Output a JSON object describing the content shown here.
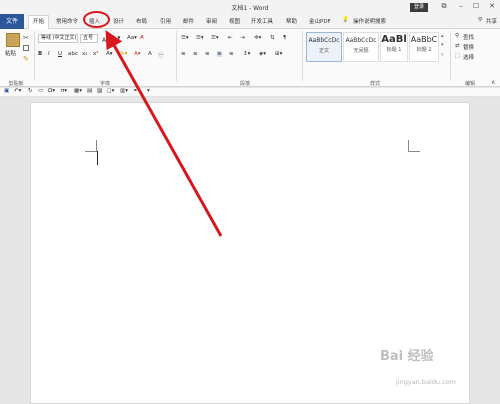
{
  "window": {
    "title": "文档1 - Word",
    "login_label": "登录",
    "minimize_glyph": "–",
    "restore_glyph": "☐",
    "close_glyph": "✕",
    "restore_icon": "restore-window-icon"
  },
  "tabs": [
    {
      "label": "文件"
    },
    {
      "label": "开始"
    },
    {
      "label": "常用命令"
    },
    {
      "label": "插入"
    },
    {
      "label": "设计"
    },
    {
      "label": "布局"
    },
    {
      "label": "引用"
    },
    {
      "label": "邮件"
    },
    {
      "label": "审阅"
    },
    {
      "label": "视图"
    },
    {
      "label": "开发工具"
    },
    {
      "label": "帮助"
    },
    {
      "label": "金山PDF"
    },
    {
      "label": "操作说明搜索"
    }
  ],
  "share_label": "共享",
  "ribbon": {
    "clipboard": {
      "paste_label": "粘贴",
      "group_label": "剪贴板"
    },
    "font": {
      "font_name": "等线 (中文正文)",
      "font_size": "五号",
      "bold": "B",
      "italic": "I",
      "underline": "U",
      "group_label": "字体"
    },
    "paragraph": {
      "group_label": "段落"
    },
    "styles": {
      "items": [
        {
          "sample": "AaBbCcDc",
          "name": "正文"
        },
        {
          "sample": "AaBbCcDc",
          "name": "无间隔"
        },
        {
          "sample": "AaBl",
          "name": "标题 1"
        },
        {
          "sample": "AaBbC",
          "name": "标题 2"
        }
      ],
      "group_label": "样式"
    },
    "editing": {
      "find_label": "查找",
      "replace_label": "替换",
      "select_label": "选择",
      "group_label": "编辑"
    }
  },
  "annotation": {
    "color": "#d8181c",
    "target_tab": "插入"
  },
  "colors": {
    "file_tab": "#2b579a",
    "annotation": "#d8181c"
  },
  "watermark": {
    "main": "Bai 经验",
    "sub": "jingyan.baidu.com"
  }
}
